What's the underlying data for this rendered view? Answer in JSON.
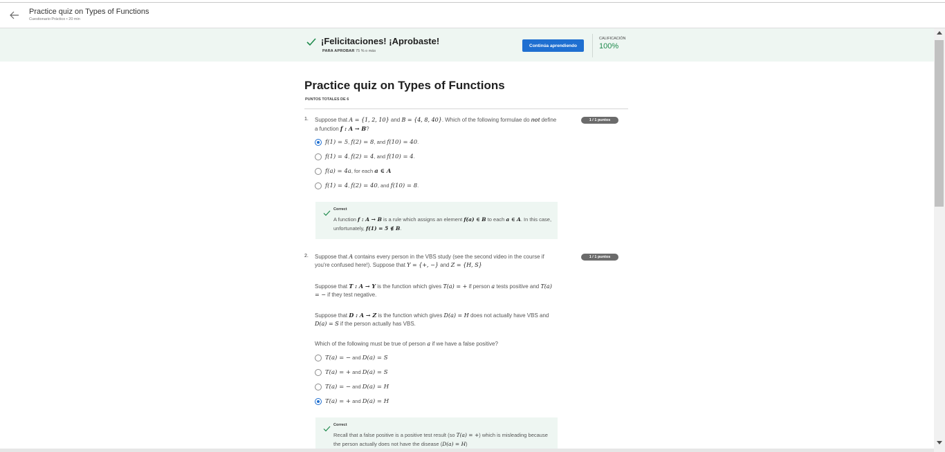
{
  "header": {
    "title": "Practice quiz on Types of Functions",
    "subtitle": "Cuestionario Práctico • 20 min"
  },
  "banner": {
    "title": "¡Felicitaciones! ¡Aprobaste!",
    "pass_label": "PARA APROBAR",
    "pass_value": "75 % o más",
    "continue_label": "Continúa aprendiendo",
    "grade_label": "CALIFICACIÓN",
    "grade_value": "100%"
  },
  "quiz": {
    "title": "Practice quiz on Types of Functions",
    "total_points": "PUNTOS TOTALES DE 6"
  },
  "q1": {
    "number": "1.",
    "points": "1 / 1 puntos",
    "text_a": "Suppose that ",
    "set_a": "A = {1, 2, 10}",
    "text_b": " and ",
    "set_b": "B = {4, 8, 40}",
    "text_c": ". Which of the following formulae do ",
    "text_not": "not",
    "text_d": " define a function ",
    "func": "f : A → B",
    "text_e": "?",
    "options": [
      {
        "m1": "f(1) = 5",
        "s1": ", ",
        "m2": "f(2) = 8",
        "s2": ", and ",
        "m3": "f(10) = 40",
        "s3": "."
      },
      {
        "m1": "f(1) = 4",
        "s1": ", ",
        "m2": "f(2) = 4",
        "s2": ", and ",
        "m3": "f(10) = 4",
        "s3": "."
      },
      {
        "m1": "f(a) = 4a",
        "s1": ", for each ",
        "m2": "a ∈ A",
        "s2": "",
        "m3": "",
        "s3": ""
      },
      {
        "m1": "f(1) = 4",
        "s1": ", ",
        "m2": "f(2) = 40",
        "s2": ", and ",
        "m3": "f(10) = 8",
        "s3": "."
      }
    ],
    "selected_index": 0,
    "feedback": {
      "title": "Correct",
      "t1": "A function ",
      "m1": "f : A → B",
      "t2": " is a rule which assigns an element ",
      "m2": "f(a) ∈ B",
      "t3": " to each ",
      "m3": "a ∈ A",
      "t4": ". In this case, unfortunately, ",
      "m4": "f(1) = 5 ∉ B",
      "t5": "."
    }
  },
  "q2": {
    "number": "2.",
    "points": "1 / 1 puntos",
    "p1_a": "Suppose that ",
    "p1_m1": "A",
    "p1_b": " contains every person in the VBS study (see the second video in the course if you're confused here!). Suppose that ",
    "p1_m2": "Y = {+, −}",
    "p1_c": " and ",
    "p1_m3": "Z = {H, S}",
    "p2_a": "Suppose that ",
    "p2_m1": "T : A → Y",
    "p2_b": " is the function which gives ",
    "p2_m2": "T(a) = +",
    "p2_c": " if person ",
    "p2_m3": "a",
    "p2_d": " tests positive and ",
    "p2_m4": "T(a) = −",
    "p2_e": " if they test negative.",
    "p3_a": "Suppose that ",
    "p3_m1": "D : A → Z",
    "p3_b": " is the function which gives ",
    "p3_m2": "D(a) = H",
    "p3_c": " does not actually have VBS and ",
    "p3_m3": "D(a) = S",
    "p3_d": " if the person actually has VBS.",
    "p4_a": "Which of the following must be true of person ",
    "p4_m1": "a",
    "p4_b": " if we have a false positive?",
    "options": [
      {
        "m1": "T(a) = −",
        "s1": " and ",
        "m2": "D(a) = S"
      },
      {
        "m1": "T(a) = +",
        "s1": " and ",
        "m2": "D(a) = S"
      },
      {
        "m1": "T(a) = −",
        "s1": " and ",
        "m2": "D(a) = H"
      },
      {
        "m1": "T(a) = +",
        "s1": " and ",
        "m2": "D(a) = H"
      }
    ],
    "selected_index": 3,
    "feedback": {
      "title": "Correct",
      "t1": "Recall that a false positive is a positive test result (so ",
      "m1": "T(a) = +",
      "t2": ") which is misleading because the person actually does not have the disease (",
      "m2": "D(a) = H",
      "t3": ")"
    }
  },
  "colors": {
    "accent": "#1f6fd1",
    "success": "#1e8a4c",
    "banner_bg": "#eef6f2"
  },
  "icons": {
    "back": "arrow-left-icon",
    "check": "checkmark-icon"
  }
}
